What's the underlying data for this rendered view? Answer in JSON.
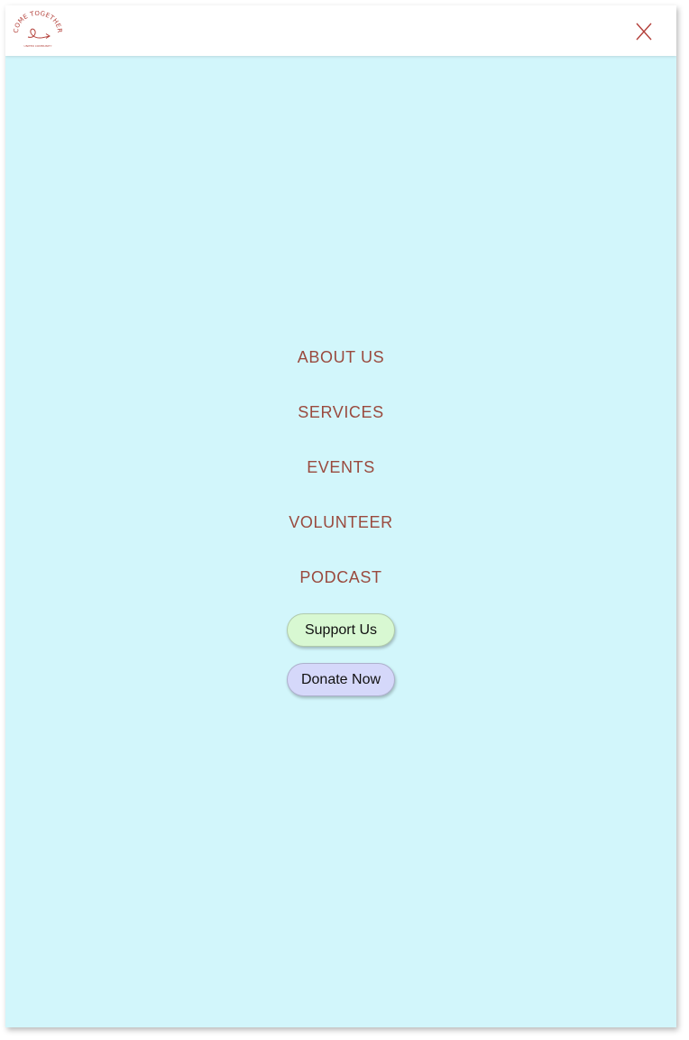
{
  "header": {
    "logo": {
      "arc_text": "COME TOGETHER",
      "sub_text": "UNITED COMMUNITY",
      "brand_color": "#b3403a"
    },
    "close_icon": "close-icon"
  },
  "nav": {
    "items": [
      {
        "label": "ABOUT US"
      },
      {
        "label": "SERVICES"
      },
      {
        "label": "EVENTS"
      },
      {
        "label": "VOLUNTEER"
      },
      {
        "label": "PODCAST"
      }
    ],
    "link_color": "#9a4a3e"
  },
  "buttons": {
    "support": {
      "label": "Support Us",
      "color": "#d8f8d2"
    },
    "donate": {
      "label": "Donate Now",
      "color": "#d5d8fa"
    }
  },
  "colors": {
    "menu_background": "#d2f6fb",
    "header_background": "#ffffff"
  }
}
